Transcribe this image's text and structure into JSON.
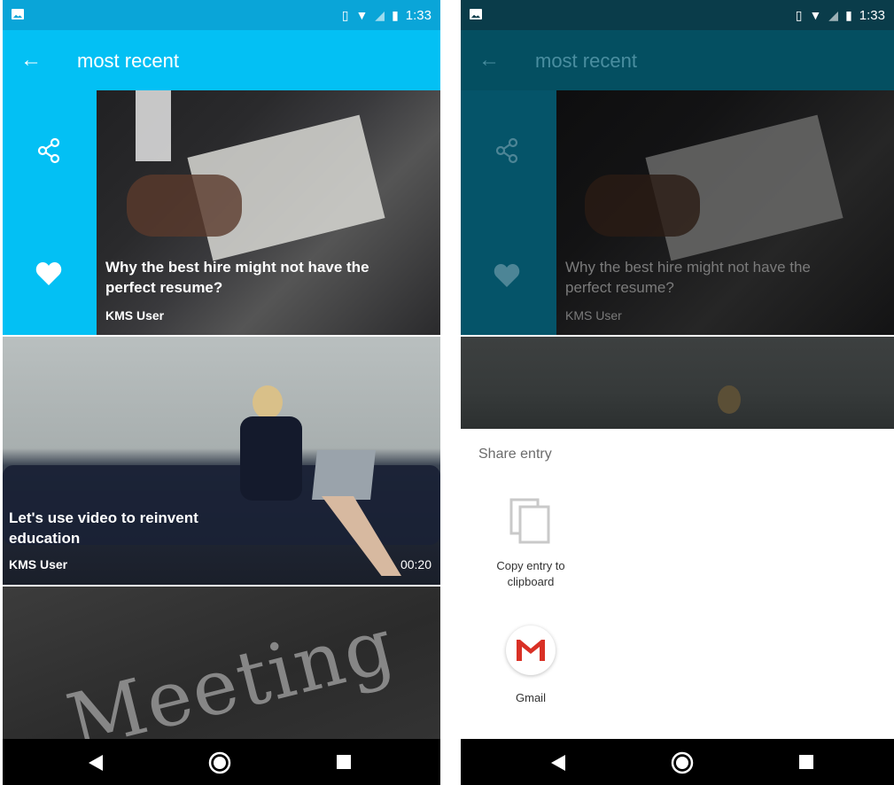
{
  "status": {
    "time": "1:33",
    "icons": [
      "vibrate-icon",
      "wifi-icon",
      "no-signal-icon",
      "battery-icon"
    ]
  },
  "app_bar": {
    "title": "most recent",
    "back_icon": "arrow-left-icon"
  },
  "feed": [
    {
      "headline": "Why the best hire might not have the perfect resume?",
      "author": "KMS User",
      "duration": ""
    },
    {
      "headline": "Let's use video to reinvent education",
      "author": "KMS User",
      "duration": "00:20"
    },
    {
      "headline": "",
      "author": "",
      "duration": ""
    }
  ],
  "share_sheet": {
    "title": "Share entry",
    "targets": [
      {
        "label": "Copy entry to clipboard",
        "icon": "copy-icon"
      },
      {
        "label": "Gmail",
        "icon": "gmail-icon"
      }
    ]
  },
  "colors": {
    "primary": "#03c0f4",
    "primary_dimmed": "#044f61",
    "gmail_red": "#d93025"
  }
}
